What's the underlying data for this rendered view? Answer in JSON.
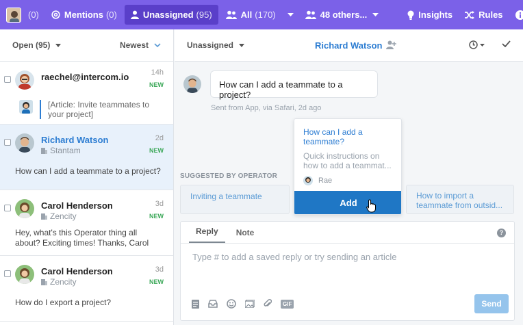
{
  "topnav": {
    "me_count": "(0)",
    "mentions_label": "Mentions",
    "mentions_count": "(0)",
    "unassigned_label": "Unassigned",
    "unassigned_count": "(95)",
    "all_label": "All",
    "all_count": "(170)",
    "others_label": "48 others...",
    "insights_label": "Insights",
    "rules_label": "Rules",
    "accent_color": "#7b61e8",
    "active_color": "#5a3fc9"
  },
  "list": {
    "filter_label": "Open (95)",
    "sort_label": "Newest",
    "conversations": [
      {
        "name": "raechel@intercom.io",
        "time": "14h",
        "badge": "NEW",
        "article_text": "[Article: Invite teammates to your project]"
      },
      {
        "name": "Richard Watson",
        "company": "Stantam",
        "time": "2d",
        "badge": "NEW",
        "preview": "How can I add a teammate to a project?"
      },
      {
        "name": "Carol Henderson",
        "company": "Zencity",
        "time": "3d",
        "badge": "NEW",
        "preview": "Hey, what's this Operator thing all about? Exciting times! Thanks, Carol"
      },
      {
        "name": "Carol Henderson",
        "company": "Zencity",
        "time": "3d",
        "badge": "NEW",
        "preview": "How do I export a project?"
      }
    ]
  },
  "conversation": {
    "assign_label": "Unassigned",
    "person_name": "Richard Watson",
    "message": "How can I add a teammate to a project?",
    "meta": "Sent from App, via Safari, 2d ago",
    "suggested_label": "SUGGESTED BY OPERATOR",
    "suggestion_left": "Inviting a teammate",
    "suggestion_right": "How to import a teammate from outsid...",
    "card": {
      "title": "How can I add a teammate?",
      "description": "Quick instructions on how to add a teammat...",
      "author": "Rae",
      "add_label": "Add"
    }
  },
  "composer": {
    "tab_reply": "Reply",
    "tab_note": "Note",
    "help": "?",
    "placeholder": "Type # to add a saved reply or try sending an article",
    "gif_label": "GIF",
    "send_label": "Send"
  }
}
